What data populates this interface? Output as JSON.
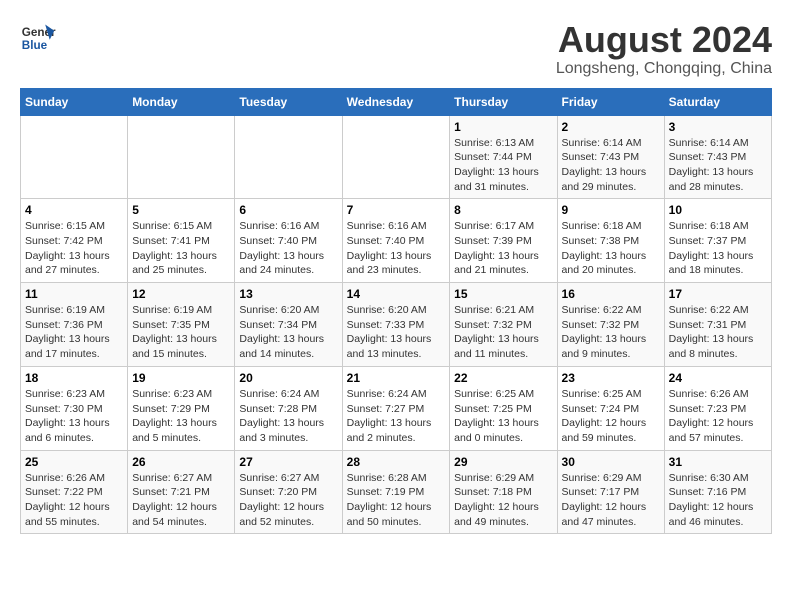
{
  "header": {
    "logo_line1": "General",
    "logo_line2": "Blue",
    "title": "August 2024",
    "subtitle": "Longsheng, Chongqing, China"
  },
  "calendar": {
    "days_of_week": [
      "Sunday",
      "Monday",
      "Tuesday",
      "Wednesday",
      "Thursday",
      "Friday",
      "Saturday"
    ],
    "weeks": [
      [
        {
          "day": "",
          "info": ""
        },
        {
          "day": "",
          "info": ""
        },
        {
          "day": "",
          "info": ""
        },
        {
          "day": "",
          "info": ""
        },
        {
          "day": "1",
          "info": "Sunrise: 6:13 AM\nSunset: 7:44 PM\nDaylight: 13 hours and 31 minutes."
        },
        {
          "day": "2",
          "info": "Sunrise: 6:14 AM\nSunset: 7:43 PM\nDaylight: 13 hours and 29 minutes."
        },
        {
          "day": "3",
          "info": "Sunrise: 6:14 AM\nSunset: 7:43 PM\nDaylight: 13 hours and 28 minutes."
        }
      ],
      [
        {
          "day": "4",
          "info": "Sunrise: 6:15 AM\nSunset: 7:42 PM\nDaylight: 13 hours and 27 minutes."
        },
        {
          "day": "5",
          "info": "Sunrise: 6:15 AM\nSunset: 7:41 PM\nDaylight: 13 hours and 25 minutes."
        },
        {
          "day": "6",
          "info": "Sunrise: 6:16 AM\nSunset: 7:40 PM\nDaylight: 13 hours and 24 minutes."
        },
        {
          "day": "7",
          "info": "Sunrise: 6:16 AM\nSunset: 7:40 PM\nDaylight: 13 hours and 23 minutes."
        },
        {
          "day": "8",
          "info": "Sunrise: 6:17 AM\nSunset: 7:39 PM\nDaylight: 13 hours and 21 minutes."
        },
        {
          "day": "9",
          "info": "Sunrise: 6:18 AM\nSunset: 7:38 PM\nDaylight: 13 hours and 20 minutes."
        },
        {
          "day": "10",
          "info": "Sunrise: 6:18 AM\nSunset: 7:37 PM\nDaylight: 13 hours and 18 minutes."
        }
      ],
      [
        {
          "day": "11",
          "info": "Sunrise: 6:19 AM\nSunset: 7:36 PM\nDaylight: 13 hours and 17 minutes."
        },
        {
          "day": "12",
          "info": "Sunrise: 6:19 AM\nSunset: 7:35 PM\nDaylight: 13 hours and 15 minutes."
        },
        {
          "day": "13",
          "info": "Sunrise: 6:20 AM\nSunset: 7:34 PM\nDaylight: 13 hours and 14 minutes."
        },
        {
          "day": "14",
          "info": "Sunrise: 6:20 AM\nSunset: 7:33 PM\nDaylight: 13 hours and 13 minutes."
        },
        {
          "day": "15",
          "info": "Sunrise: 6:21 AM\nSunset: 7:32 PM\nDaylight: 13 hours and 11 minutes."
        },
        {
          "day": "16",
          "info": "Sunrise: 6:22 AM\nSunset: 7:32 PM\nDaylight: 13 hours and 9 minutes."
        },
        {
          "day": "17",
          "info": "Sunrise: 6:22 AM\nSunset: 7:31 PM\nDaylight: 13 hours and 8 minutes."
        }
      ],
      [
        {
          "day": "18",
          "info": "Sunrise: 6:23 AM\nSunset: 7:30 PM\nDaylight: 13 hours and 6 minutes."
        },
        {
          "day": "19",
          "info": "Sunrise: 6:23 AM\nSunset: 7:29 PM\nDaylight: 13 hours and 5 minutes."
        },
        {
          "day": "20",
          "info": "Sunrise: 6:24 AM\nSunset: 7:28 PM\nDaylight: 13 hours and 3 minutes."
        },
        {
          "day": "21",
          "info": "Sunrise: 6:24 AM\nSunset: 7:27 PM\nDaylight: 13 hours and 2 minutes."
        },
        {
          "day": "22",
          "info": "Sunrise: 6:25 AM\nSunset: 7:25 PM\nDaylight: 13 hours and 0 minutes."
        },
        {
          "day": "23",
          "info": "Sunrise: 6:25 AM\nSunset: 7:24 PM\nDaylight: 12 hours and 59 minutes."
        },
        {
          "day": "24",
          "info": "Sunrise: 6:26 AM\nSunset: 7:23 PM\nDaylight: 12 hours and 57 minutes."
        }
      ],
      [
        {
          "day": "25",
          "info": "Sunrise: 6:26 AM\nSunset: 7:22 PM\nDaylight: 12 hours and 55 minutes."
        },
        {
          "day": "26",
          "info": "Sunrise: 6:27 AM\nSunset: 7:21 PM\nDaylight: 12 hours and 54 minutes."
        },
        {
          "day": "27",
          "info": "Sunrise: 6:27 AM\nSunset: 7:20 PM\nDaylight: 12 hours and 52 minutes."
        },
        {
          "day": "28",
          "info": "Sunrise: 6:28 AM\nSunset: 7:19 PM\nDaylight: 12 hours and 50 minutes."
        },
        {
          "day": "29",
          "info": "Sunrise: 6:29 AM\nSunset: 7:18 PM\nDaylight: 12 hours and 49 minutes."
        },
        {
          "day": "30",
          "info": "Sunrise: 6:29 AM\nSunset: 7:17 PM\nDaylight: 12 hours and 47 minutes."
        },
        {
          "day": "31",
          "info": "Sunrise: 6:30 AM\nSunset: 7:16 PM\nDaylight: 12 hours and 46 minutes."
        }
      ]
    ]
  },
  "accent_color": "#2a6ebb"
}
